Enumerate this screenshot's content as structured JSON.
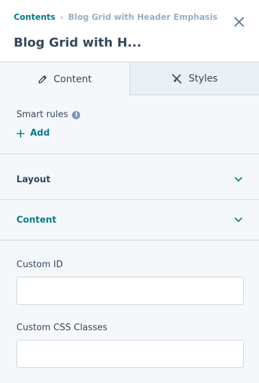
{
  "breadcrumb": {
    "parent": "Contents",
    "current": "Blog Grid with Header Emphasis"
  },
  "header": {
    "title": "Blog Grid with H...",
    "close_icon": "close-icon"
  },
  "tabs": [
    {
      "label": "Content",
      "icon": "pencil-icon",
      "active": true
    },
    {
      "label": "Styles",
      "icon": "brush-icon",
      "active": false
    }
  ],
  "smart_rules": {
    "label": "Smart rules",
    "info_icon": "info-icon",
    "add_label": "Add"
  },
  "sections": [
    {
      "label": "Layout",
      "expanded": false
    },
    {
      "label": "Content",
      "expanded": false
    }
  ],
  "fields": {
    "custom_id": {
      "label": "Custom ID",
      "value": "",
      "placeholder": ""
    },
    "custom_css": {
      "label": "Custom CSS Classes",
      "value": "",
      "placeholder": ""
    }
  },
  "colors": {
    "accent": "#0b7a8a",
    "text": "#33475b",
    "muted": "#99afc4",
    "border": "#cbd6e2",
    "panel_bg": "#f5f8fa",
    "inactive_tab_bg": "#eaf0f6"
  }
}
